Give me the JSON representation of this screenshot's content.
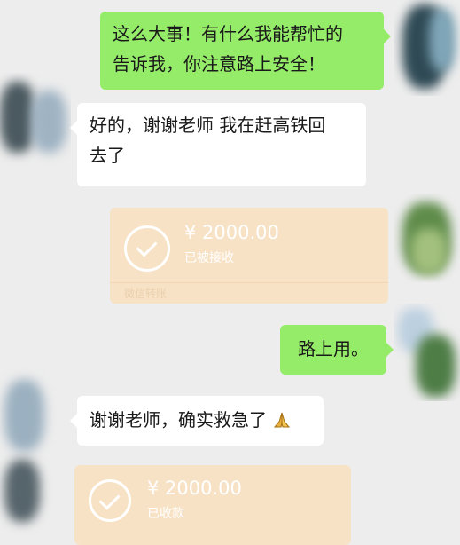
{
  "messages": [
    {
      "from": "me",
      "text_line1": "这么大事！有什么我能帮忙的",
      "text_line2": "告诉我，你注意路上安全！"
    },
    {
      "from": "other",
      "text_line1": "好的，谢谢老师 我在赶高铁回",
      "text_line2": "去了"
    },
    {
      "from": "me",
      "type": "transfer",
      "amount": "¥ 2000.00",
      "status": "已被接收",
      "footer": "微信转账"
    },
    {
      "from": "me",
      "text": "路上用。"
    },
    {
      "from": "other",
      "text": "谢谢老师，确实救急了",
      "emoji": "folded-hands-icon"
    },
    {
      "from": "other",
      "type": "transfer",
      "amount": "¥ 2000.00",
      "status": "已收款"
    }
  ],
  "colors": {
    "background": "#ededed",
    "my_bubble": "#95ec69",
    "other_bubble": "#ffffff",
    "transfer_card": "#f8e2c6"
  }
}
